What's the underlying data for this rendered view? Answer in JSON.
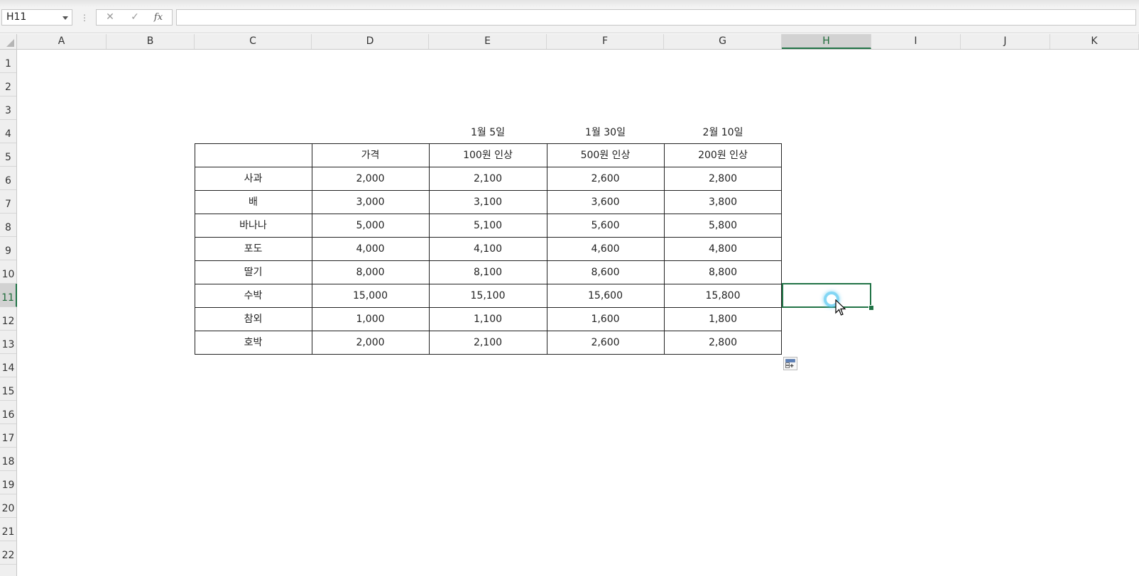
{
  "formula_bar": {
    "name_box": "H11",
    "dots": "⋮",
    "cancel_label": "✕",
    "enter_label": "✓",
    "fx_label": "fx",
    "formula": ""
  },
  "columns": [
    {
      "label": "A",
      "selected": false
    },
    {
      "label": "B",
      "selected": false
    },
    {
      "label": "C",
      "selected": false
    },
    {
      "label": "D",
      "selected": false
    },
    {
      "label": "E",
      "selected": false
    },
    {
      "label": "F",
      "selected": false
    },
    {
      "label": "G",
      "selected": false
    },
    {
      "label": "H",
      "selected": true
    },
    {
      "label": "I",
      "selected": false
    },
    {
      "label": "J",
      "selected": false
    },
    {
      "label": "K",
      "selected": false
    }
  ],
  "rows": [
    "1",
    "2",
    "3",
    "4",
    "5",
    "6",
    "7",
    "8",
    "9",
    "10",
    "11",
    "12",
    "13",
    "14",
    "15",
    "16",
    "17",
    "18",
    "19",
    "20",
    "21",
    "22"
  ],
  "selected_row": "11",
  "table": {
    "dates": [
      "1월 5일",
      "1월 30일",
      "2월 10일"
    ],
    "header": [
      "",
      "가격",
      "100원 인상",
      "500원 인상",
      "200원 인상"
    ],
    "rows": [
      [
        "사과",
        "2,000",
        "2,100",
        "2,600",
        "2,800"
      ],
      [
        "배",
        "3,000",
        "3,100",
        "3,600",
        "3,800"
      ],
      [
        "바나나",
        "5,000",
        "5,100",
        "5,600",
        "5,800"
      ],
      [
        "포도",
        "4,000",
        "4,100",
        "4,600",
        "4,800"
      ],
      [
        "딸기",
        "8,000",
        "8,100",
        "8,600",
        "8,800"
      ],
      [
        "수박",
        "15,000",
        "15,100",
        "15,600",
        "15,800"
      ],
      [
        "참외",
        "1,000",
        "1,100",
        "1,600",
        "1,800"
      ],
      [
        "호박",
        "2,000",
        "2,100",
        "2,600",
        "2,800"
      ]
    ]
  },
  "colors": {
    "selection": "#217346",
    "header_bg": "#efefef",
    "cursor_highlight": "#5ac8f0"
  },
  "icons": {
    "quick_analysis": "quick-analysis-icon",
    "cursor": "mouse-cursor-icon"
  }
}
